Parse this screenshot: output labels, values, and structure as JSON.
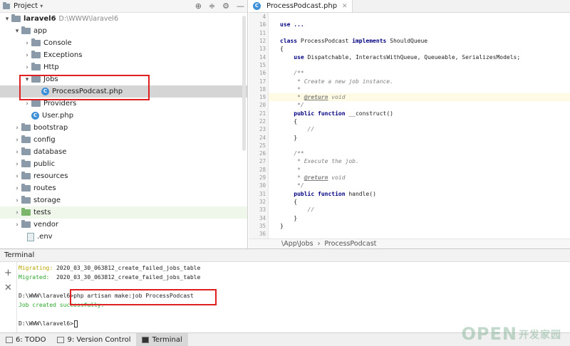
{
  "project": {
    "title": "Project",
    "items": [
      {
        "label": "laravel6",
        "path": "D:\\WWW\\laravel6"
      },
      {
        "label": "app"
      },
      {
        "label": "Console"
      },
      {
        "label": "Exceptions"
      },
      {
        "label": "Http"
      },
      {
        "label": "Jobs"
      },
      {
        "label": "ProcessPodcast.php"
      },
      {
        "label": "Providers"
      },
      {
        "label": "User.php"
      },
      {
        "label": "bootstrap"
      },
      {
        "label": "config"
      },
      {
        "label": "database"
      },
      {
        "label": "public"
      },
      {
        "label": "resources"
      },
      {
        "label": "routes"
      },
      {
        "label": "storage"
      },
      {
        "label": "tests"
      },
      {
        "label": "vendor"
      },
      {
        "label": ".env"
      }
    ]
  },
  "editor": {
    "tab": "ProcessPodcast.php",
    "lines": [
      {
        "n": "4",
        "t": ""
      },
      {
        "n": "10",
        "t": "use ..."
      },
      {
        "n": "11",
        "t": ""
      },
      {
        "n": "12",
        "t": "class ProcessPodcast implements ShouldQueue"
      },
      {
        "n": "13",
        "t": "{"
      },
      {
        "n": "14",
        "t": "    use Dispatchable, InteractsWithQueue, Queueable, SerializesModels;"
      },
      {
        "n": "15",
        "t": ""
      },
      {
        "n": "16",
        "t": "    /**"
      },
      {
        "n": "17",
        "t": "     * Create a new job instance."
      },
      {
        "n": "18",
        "t": "     *"
      },
      {
        "n": "19",
        "t": "     * @return void"
      },
      {
        "n": "20",
        "t": "     */"
      },
      {
        "n": "21",
        "t": "    public function __construct()"
      },
      {
        "n": "22",
        "t": "    {"
      },
      {
        "n": "23",
        "t": "        //"
      },
      {
        "n": "24",
        "t": "    }"
      },
      {
        "n": "25",
        "t": ""
      },
      {
        "n": "26",
        "t": "    /**"
      },
      {
        "n": "27",
        "t": "     * Execute the job."
      },
      {
        "n": "28",
        "t": "     *"
      },
      {
        "n": "29",
        "t": "     * @return void"
      },
      {
        "n": "30",
        "t": "     */"
      },
      {
        "n": "31",
        "t": "    public function handle()"
      },
      {
        "n": "32",
        "t": "    {"
      },
      {
        "n": "33",
        "t": "        //"
      },
      {
        "n": "34",
        "t": "    }"
      },
      {
        "n": "35",
        "t": "}"
      },
      {
        "n": "36",
        "t": ""
      }
    ],
    "breadcrumb": [
      "\\App\\Jobs",
      "ProcessPodcast"
    ]
  },
  "terminal": {
    "title": "Terminal",
    "lines": [
      {
        "prefix": "Migrating:",
        "text": " 2020_03_30_063812_create_failed_jobs_table"
      },
      {
        "prefix": "Migrated:",
        "text": "  2020_03_30_063812_create_failed_jobs_table"
      },
      {
        "prefix": "",
        "text": ""
      },
      {
        "prefix": "D:\\WWW\\laravel6>",
        "text": "php artisan make:job ProcessPodcast"
      },
      {
        "prefix": "",
        "text": "Job created successfully."
      },
      {
        "prefix": "",
        "text": ""
      },
      {
        "prefix": "D:\\WWW\\laravel6>",
        "text": ""
      }
    ]
  },
  "statusbar": {
    "todo": "6: TODO",
    "vcs": "9: Version Control",
    "terminal": "Terminal"
  },
  "watermark": {
    "brand": "OPEN",
    "cn": "开发家园"
  }
}
